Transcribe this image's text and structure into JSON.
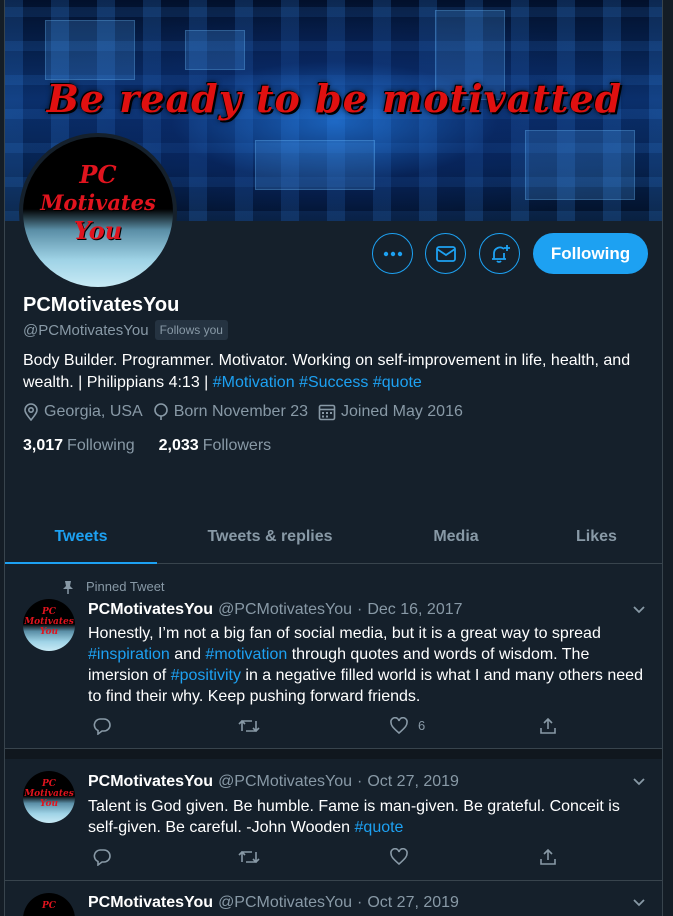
{
  "banner": {
    "text": "Be ready to be motivatted"
  },
  "avatar": {
    "text": [
      "PC",
      "Motivates",
      "You"
    ]
  },
  "profile": {
    "name": "PCMotivatesYou",
    "handle": "@PCMotivatesYou",
    "follows_you": "Follows you",
    "bio_text": "Body Builder. Programmer. Motivator. Working on self-improvement in life, health, and wealth. | Philippians 4:13 | ",
    "bio_hashtags": [
      "#Motivation",
      "#Success",
      "#quote"
    ],
    "location": "Georgia, USA",
    "born": "Born November 23",
    "joined": "Joined May 2016",
    "following_count": "3,017",
    "following_label": "Following",
    "followers_count": "2,033",
    "followers_label": "Followers"
  },
  "buttons": {
    "follow_state": "Following"
  },
  "tabs": [
    {
      "label": "Tweets",
      "active": true
    },
    {
      "label": "Tweets & replies"
    },
    {
      "label": "Media"
    },
    {
      "label": "Likes"
    }
  ],
  "pinned_label": "Pinned Tweet",
  "tweets": [
    {
      "name": "PCMotivatesYou",
      "handle": "@PCMotivatesYou",
      "dot": "·",
      "date": "Dec 16, 2017",
      "body_1": "Honestly, I’m not a big fan of social media, but it is a great way to spread ",
      "tag_1": "#inspiration",
      "body_2": " and ",
      "tag_2": "#motivation",
      "body_3": " through quotes and words of wisdom. The imersion of ",
      "tag_3": "#positivity",
      "body_4": " in a negative filled world is what I and many others need to find their why. Keep pushing forward friends.",
      "likes": "6"
    },
    {
      "name": "PCMotivatesYou",
      "handle": "@PCMotivatesYou",
      "dot": "·",
      "date": "Oct 27, 2019",
      "body_1": "Talent is God given. Be humble. Fame is man-given. Be grateful. Conceit is self-given. Be careful. -John Wooden ",
      "tag_1": "#quote"
    },
    {
      "name": "PCMotivatesYou",
      "handle": "@PCMotivatesYou",
      "dot": "·",
      "date": "Oct 27, 2019"
    }
  ],
  "colors": {
    "accent": "#1da1f2",
    "background": "#15202b",
    "muted": "#8899a6",
    "banner_text": "#e01010"
  },
  "icons": [
    "more-icon",
    "message-icon",
    "notification-bell-icon",
    "location-icon",
    "birthday-icon",
    "calendar-icon",
    "pin-icon",
    "reply-icon",
    "retweet-icon",
    "like-icon",
    "share-icon",
    "caret-down-icon"
  ]
}
